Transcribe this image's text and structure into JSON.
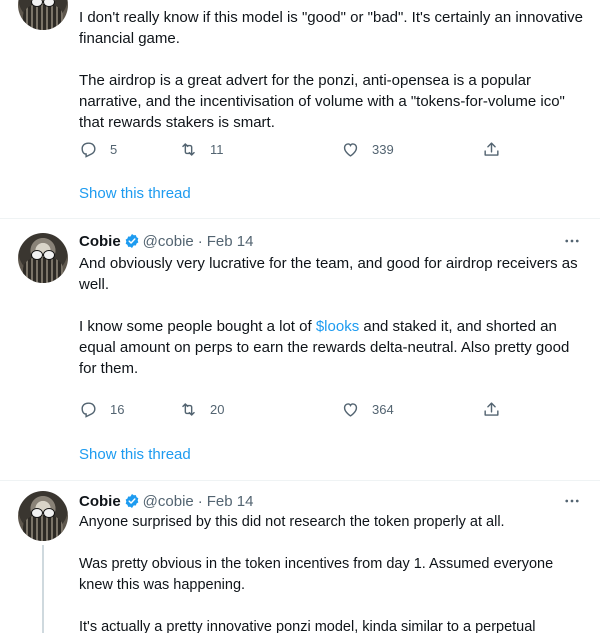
{
  "tweets": [
    {
      "text": [
        "I don't really know if this model is \"good\" or \"bad\". It's certainly an innovative financial game.",
        "The airdrop is a great advert for the ponzi, anti-opensea is a popular narrative, and the incentivisation of volume with a  \"tokens-for-volume ico\" that rewards stakers is smart."
      ],
      "replies": "5",
      "retweets": "11",
      "likes": "339",
      "show_thread": "Show this thread"
    },
    {
      "name": "Cobie",
      "handle": "@cobie",
      "separator": "·",
      "date": "Feb 14",
      "text_p1": "And obviously very lucrative for the team, and good for airdrop receivers as well.",
      "text_p2_before": "I know some people bought a lot of ",
      "cashtag": "$looks",
      "text_p2_after": " and staked it, and shorted an equal amount on perps to earn the rewards delta-neutral. Also pretty good for them.",
      "replies": "16",
      "retweets": "20",
      "likes": "364",
      "show_thread": "Show this thread"
    },
    {
      "name": "Cobie",
      "handle": "@cobie",
      "separator": "·",
      "date": "Feb 14",
      "text": [
        "Anyone surprised by this did not research the token properly at all.",
        "Was pretty obvious in the token incentives from day 1. Assumed everyone knew this was happening.",
        "It's actually a pretty innovative ponzi model, kinda similar to a perpetual"
      ]
    }
  ],
  "icons": {
    "reply": "reply-icon",
    "retweet": "retweet-icon",
    "like": "heart-icon",
    "share": "share-icon",
    "verified": "verified-badge-icon",
    "more": "more-icon"
  },
  "colors": {
    "link": "#1d9bf0",
    "secondary": "#536471",
    "text": "#0f1419"
  }
}
